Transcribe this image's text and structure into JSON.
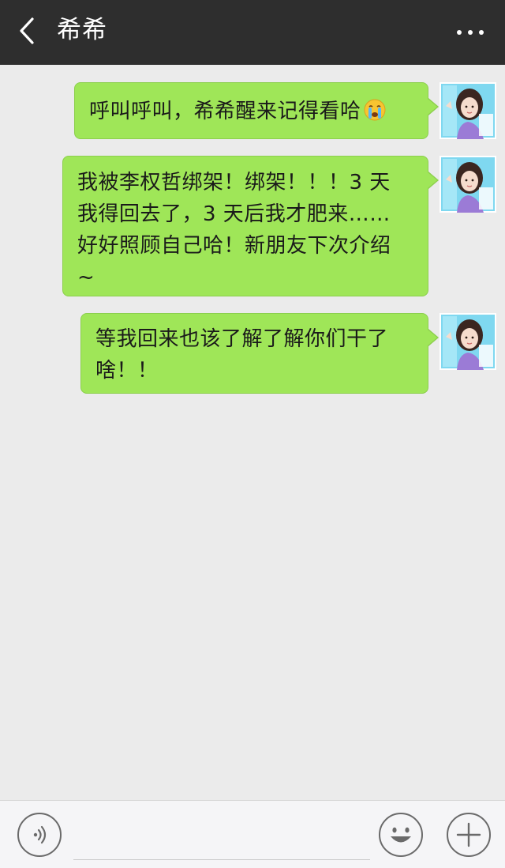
{
  "header": {
    "title": "希希",
    "back_icon": "chevron-left-icon",
    "more_icon": "more-dots-icon"
  },
  "messages": [
    {
      "text": "呼叫呼叫，希希醒来记得看哈",
      "emoji": "crying-face-icon",
      "sender": "self"
    },
    {
      "lines": [
        "我被李权哲绑架！绑架！！！3 天",
        "我得回去了，3 天后我才肥来……",
        "好好照顾自己哈！新朋友下次介绍",
        "~"
      ],
      "sender": "self"
    },
    {
      "lines": [
        "等我回来也该了解了解你们干了",
        "啥！！"
      ],
      "sender": "self"
    }
  ],
  "input_bar": {
    "voice_icon": "voice-icon",
    "emoji_icon": "emoji-icon",
    "plus_icon": "plus-icon",
    "input_value": ""
  },
  "colors": {
    "header_bg": "#2e2e2e",
    "bubble_bg": "#9fe658",
    "chat_bg": "#ebebeb",
    "input_bg": "#f5f5f7"
  }
}
